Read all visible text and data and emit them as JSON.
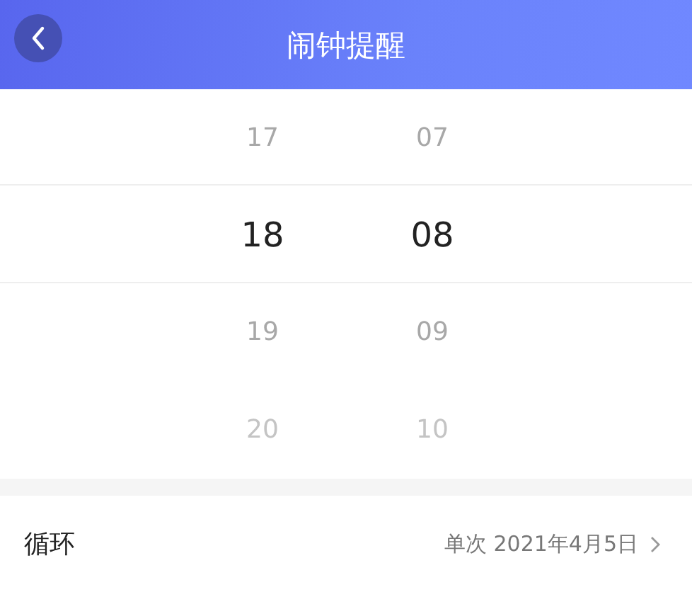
{
  "header": {
    "title": "闹钟提醒"
  },
  "picker": {
    "columns": [
      {
        "items": [
          {
            "label": "17",
            "selected": false
          },
          {
            "label": "18",
            "selected": true
          },
          {
            "label": "19",
            "selected": false
          },
          {
            "label": "20",
            "selected": false
          }
        ]
      },
      {
        "items": [
          {
            "label": "07",
            "selected": false
          },
          {
            "label": "08",
            "selected": true
          },
          {
            "label": "09",
            "selected": false
          },
          {
            "label": "10",
            "selected": false
          }
        ]
      }
    ]
  },
  "settings": [
    {
      "label": "循环",
      "value": "单次 2021年4月5日"
    }
  ]
}
